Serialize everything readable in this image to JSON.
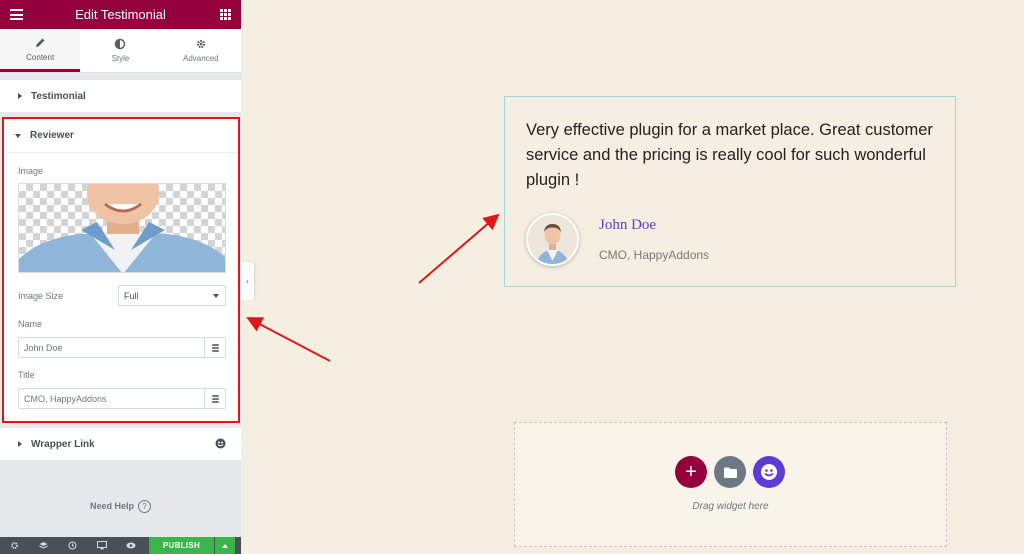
{
  "panel": {
    "title": "Edit Testimonial",
    "tabs": [
      {
        "label": "Content",
        "icon": "pencil-icon",
        "active": true
      },
      {
        "label": "Style",
        "icon": "half-circle-icon",
        "active": false
      },
      {
        "label": "Advanced",
        "icon": "gear-icon",
        "active": false
      }
    ],
    "sections": {
      "testimonial": "Testimonial",
      "reviewer": "Reviewer",
      "wrapper_link": "Wrapper Link"
    },
    "reviewer": {
      "image_label": "Image",
      "image_size_label": "Image Size",
      "image_size_value": "Full",
      "name_label": "Name",
      "name_value": "John Doe",
      "title_label": "Title",
      "title_value": "CMO, HappyAddons"
    },
    "need_help": "Need Help",
    "help_glyph": "?",
    "publish_label": "PUBLISH",
    "collapse_glyph": "‹"
  },
  "preview": {
    "quote": "Very effective plugin for a market place. Great customer service and the pricing is really cool for such wonderful plugin !",
    "name": "John Doe",
    "title": "CMO, HappyAddons",
    "drag_text": "Drag widget here",
    "add_glyph": "+"
  },
  "colors": {
    "brand": "#93003c",
    "publish": "#39b54a",
    "highlight_border": "#e0161b",
    "name_link": "#5f3bd6",
    "happy_purple": "#5f3bd6"
  }
}
